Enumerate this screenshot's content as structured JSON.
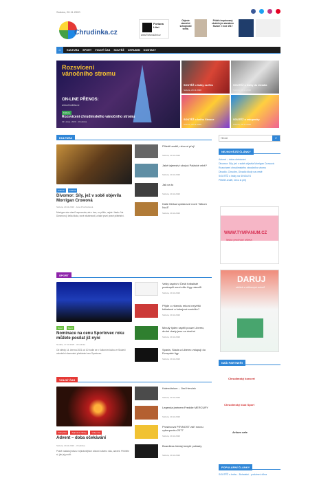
{
  "topbar": {
    "date": "Sobota, 20.11.2020",
    "social": [
      {
        "name": "facebook-icon",
        "color": "#3b5998"
      },
      {
        "name": "twitter-icon",
        "color": "#1da1f2"
      },
      {
        "name": "instagram-icon",
        "color": "#c13584"
      },
      {
        "name": "pinterest-icon",
        "color": "#e60023"
      }
    ]
  },
  "header": {
    "logo_text": "Chrudinka.cz",
    "ad_left": {
      "title": "Fortuna Libri",
      "url": "www.FortunaLibri.cz"
    },
    "ad_middle_text": "Objevte zázračné schopnosti světa.",
    "ad_right_text": "Příběh inspirovaný skutečným zázrakem Slunce v roce 1917"
  },
  "nav": {
    "home_icon": "home-icon",
    "items": [
      "KULTURA",
      "SPORT",
      "VOLNÝ ČAS",
      "SOUTĚŽ",
      "CHRUDIM",
      "KONTAKT"
    ]
  },
  "hero": {
    "headline": "Rozsvícení vánočního stromu",
    "live": "ON-LINE PŘENOS:",
    "sub": "www.chrudinka.cz",
    "category": "Kultura",
    "title": "Rozsvícení chrudimského vánočního stromu",
    "meta": "29 Listop. 2020 · chrudinka"
  },
  "tiles": [
    {
      "title": "SOUTĚŽ o lístky na film",
      "meta": "Sobota, 20.11.2020"
    },
    {
      "title": "SOUTĚŽ o lístky do divadla",
      "meta": "Sobota, 20.11.2020"
    },
    {
      "title": "SOUTĚŽ o knihu Vánoce",
      "meta": "Sobota, 20.11.2020"
    },
    {
      "title": "SOUTĚŽ o vstupenky",
      "meta": "Sobota, 20.11.2020"
    }
  ],
  "sections": {
    "kultura": "KULTURA",
    "sport": "SPORT",
    "volny_cas": "VOLNÝ ČAS"
  },
  "kultura": {
    "tags": [
      "Kultura",
      "Kultura"
    ],
    "title": "Divomor: Síly, jež v sobě objevila Morrigan Crowová",
    "meta": "Sobota, 20.11.2020 · Jana Procházková",
    "excerpt": "Morrigan sice domů nepoznala, ale v tom, co přišlo, najde i lásku. Na Divomoru ji čeká škola, nové zkušenosti, a také první pravé přátelství.",
    "items": [
      {
        "title": "Přiletěl anděl, něco si přej!",
        "meta": "Sobota, 20.11.2020"
      },
      {
        "title": "Jaké tajemství ukrývá Palácké vrbě?",
        "meta": "Sobota, 20.11.2020"
      },
      {
        "title": "Jak na to",
        "meta": "Sobota, 20.11.2020"
      },
      {
        "title": "Katie Melua vydala své nové \"Album No.8\"",
        "meta": "Sobota, 20.11.2020"
      }
    ]
  },
  "sport": {
    "tags": [
      "Sport",
      "Sport"
    ],
    "title": "Nominace na cenu Sportovec roku můžete posílat již nyní",
    "meta": "Neděle, 17.10.2020 · chrudinka",
    "excerpt": "Od středy 14. června 2021 od 10 hodin se v Kulturním klubu ve Skuteči uskuteční slavnostní předávání cen Sportovec.",
    "items": [
      {
        "title": "Velký úspěch! Čeští fotbalisté postoupili mezi elitu Ligy národů",
        "meta": "Sobota, 20.11.2020"
      },
      {
        "title": "Přijde o víkendu rekord největší fotbalové a hokejové soutěže?",
        "meta": "Sobota, 20.11.2020"
      },
      {
        "title": "Minulý týden uspěli pouze Liberec, druhé duely jsou za dveřmi",
        "meta": "Sobota, 20.11.2020"
      },
      {
        "title": "Sparta, Slavia a Liberec vstupují do Evropské ligy",
        "meta": "Sobota, 20.11.2020"
      }
    ]
  },
  "volny_cas": {
    "tags": [
      "Volný čas",
      "Zajímavé články",
      "Volný čas"
    ],
    "title": "Advent – doba očekávání",
    "meta": "Sobota, 20.11.2020 · chrudinka",
    "excerpt": "Právě nastala jedna z nejkrásnějších období našeho roku, advent. Přečtěte si, jak jej prožít.",
    "items": [
      {
        "title": "Kalendárium – Jimi Hendrix",
        "meta": "Sobota, 20.11.2020"
      },
      {
        "title": "Legenda jménem Freddie MERCURY",
        "meta": "Sobota, 20.11.2020"
      },
      {
        "title": "Prosincová PEVNOST září novou cyberpunku 2077",
        "meta": "Sobota, 20.11.2020"
      },
      {
        "title": "Boardless hledají skryté poklady",
        "meta": "Sobota, 20.11.2020"
      }
    ]
  },
  "sidebar": {
    "search_placeholder": "Hledat",
    "recent_title": "NEJNOVĚJŠÍ ČLÁNKY",
    "recent": [
      "Advent – doba očekávání",
      "Divomor: Síly, jež v sobě objevila Morrigan Crowová",
      "Rozsvícení chrudimského vánočního stromu",
      "Divadlo, Chrudim, Divadlo školy na cestě",
      "SOUTĚŽ o lístky na SINGLES",
      "Přiletěl anděl, něco si přej"
    ],
    "banner1_title": "WWW.TYMPANUM.CZ",
    "banner1_sub": "láska prochází ušima",
    "banner2_title": "DARUJ",
    "banner2_sub": "zážitek z oblíbených autorů",
    "partners_title": "NAŠI PARTNEŘI",
    "partners": [
      "Chrudimský koncert",
      "Chrudimský klub Sport",
      "Artium cafe"
    ],
    "popular_title": "POPULÁRNÍ ČLÁNKY",
    "popular": "SOUTĚŽ o knihu - Bohatství - podzimní dílna"
  }
}
